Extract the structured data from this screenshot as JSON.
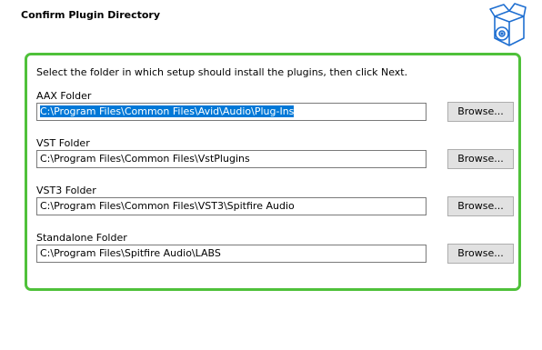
{
  "header": {
    "title": "Confirm Plugin Directory",
    "logo_icon": "software-box-disc-icon"
  },
  "main": {
    "instruction": "Select the folder in which setup should install the plugins, then click Next.",
    "browse_label": "Browse...",
    "folders": [
      {
        "label": "AAX Folder",
        "path": "C:\\Program Files\\Common Files\\Avid\\Audio\\Plug-Ins",
        "selected": true
      },
      {
        "label": "VST Folder",
        "path": "C:\\Program Files\\Common Files\\VstPlugins",
        "selected": false
      },
      {
        "label": "VST3 Folder",
        "path": "C:\\Program Files\\Common Files\\VST3\\Spitfire Audio",
        "selected": false
      },
      {
        "label": "Standalone Folder",
        "path": "C:\\Program Files\\Spitfire Audio\\LABS",
        "selected": false
      }
    ]
  },
  "colors": {
    "highlight_border": "#4fc13a",
    "selection": "#0078d7",
    "logo_blue": "#1f6fd1"
  }
}
